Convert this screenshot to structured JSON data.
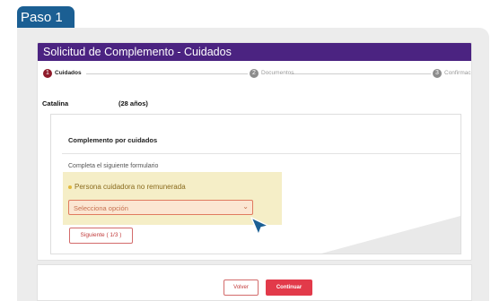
{
  "step_tab": "Paso 1",
  "form": {
    "title": "Solicitud de Complemento - Cuidados",
    "steps": [
      {
        "number": "1",
        "label": "Cuidados",
        "active": true
      },
      {
        "number": "2",
        "label": "Documentos",
        "active": false
      },
      {
        "number": "3",
        "label": "Confirmación",
        "active": false
      }
    ],
    "person": {
      "name": "Catalina",
      "age": "(28 años)"
    }
  },
  "section": {
    "title": "Complemento por cuidados",
    "subtitle": "Completa el siguiente formulario",
    "question_label": "Persona cuidadora no remunerada",
    "select_placeholder": "Selecciona opción",
    "next_button": "Siguiente ( 1/3 )"
  },
  "footer": {
    "back_button": "Volver",
    "continue_button": "Continuar"
  },
  "colors": {
    "step_tab": "#1b5f93",
    "title_bar": "#4b2381",
    "active_step": "#8e1a2a",
    "highlight": "#f5eec7",
    "select_border": "#e07a5f",
    "primary_button": "#e23a4a",
    "cursor": "#1b5f93"
  },
  "icons": {
    "select_chevron": "chevron-down-icon",
    "cursor": "mouse-pointer-icon"
  }
}
